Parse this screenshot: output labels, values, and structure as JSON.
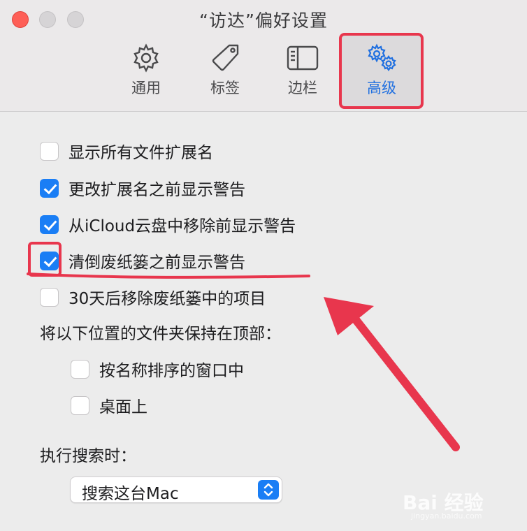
{
  "window": {
    "title": "“访达”偏好设置"
  },
  "tabs": [
    {
      "label": "通用",
      "icon": "gear-icon"
    },
    {
      "label": "标签",
      "icon": "tag-icon"
    },
    {
      "label": "边栏",
      "icon": "sidebar-icon"
    },
    {
      "label": "高级",
      "icon": "gears-icon",
      "selected": true
    }
  ],
  "options": [
    {
      "label": "显示所有文件扩展名",
      "checked": false
    },
    {
      "label": "更改扩展名之前显示警告",
      "checked": true
    },
    {
      "label": "从iCloud云盘中移除前显示警告",
      "checked": true
    },
    {
      "label": "清倒废纸篓之前显示警告",
      "checked": true
    },
    {
      "label": "30天后移除废纸篓中的项目",
      "checked": false
    }
  ],
  "keep_folders": {
    "label": "将以下位置的文件夹保持在顶部：",
    "options": [
      {
        "label": "按名称排序的窗口中",
        "checked": false
      },
      {
        "label": "桌面上",
        "checked": false
      }
    ]
  },
  "search": {
    "label": "执行搜索时：",
    "selected": "搜索这台Mac"
  },
  "watermark": {
    "text": "Bai 经验",
    "sub": "jingyan.baidu.com"
  },
  "colors": {
    "accent": "#1a7ef5",
    "annotation": "#e8364d"
  }
}
